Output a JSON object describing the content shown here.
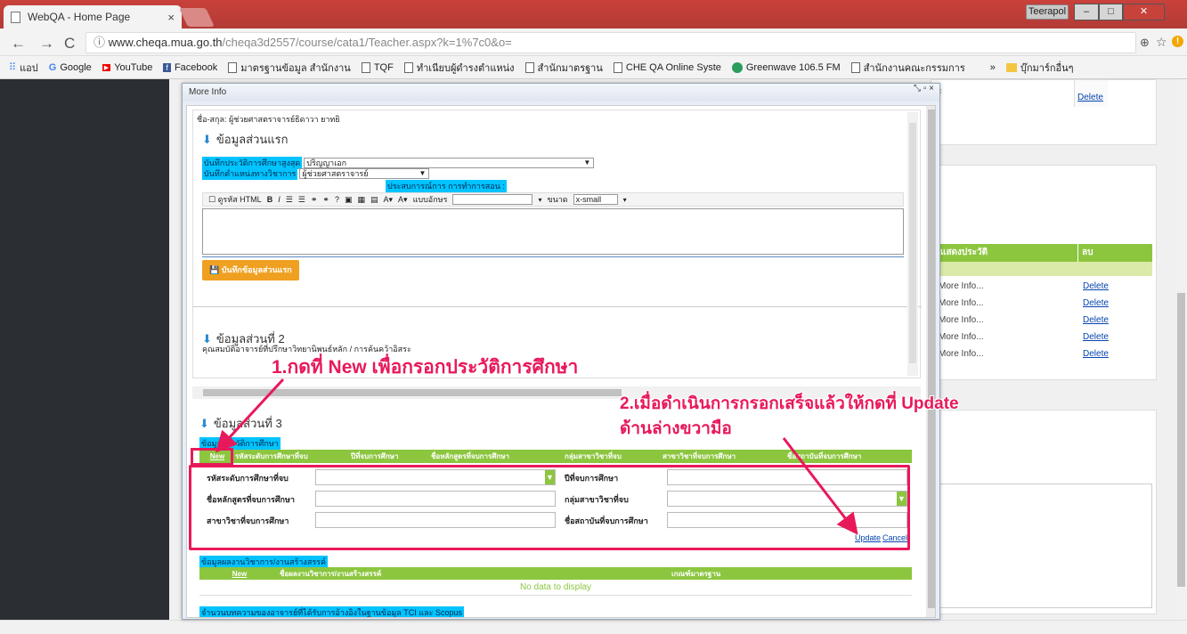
{
  "browser": {
    "tab_title": "WebQA - Home Page",
    "tab_close": "×",
    "user": "Teerapol",
    "url_host": "www.cheqa.mua.go.th",
    "url_path": "/cheqa3d2557/course/cata1/Teacher.aspx?k=1%7c0&o=",
    "bookmarks": [
      "แอป",
      "Google",
      "YouTube",
      "Facebook",
      "มาตรฐานข้อมูล สำนักงาน",
      "TQF",
      "ทำเนียบผู้ดำรงตำแหน่ง",
      "สำนักมาตรฐาน",
      "CHE QA Online Syste",
      "Greenwave 106.5 FM",
      "สำนักงานคณะกรรมการ"
    ],
    "bookmarks_more": "»",
    "bookmark_folder": "บุ๊กมาร์กอื่นๆ"
  },
  "right_panel": {
    "delete_top": "Delete",
    "col1": "แสดงประวัติ",
    "col2": "ลบ",
    "rows": [
      {
        "info": "More Info...",
        "del": "Delete"
      },
      {
        "info": "More Info...",
        "del": "Delete"
      },
      {
        "info": "More Info...",
        "del": "Delete"
      },
      {
        "info": "More Info...",
        "del": "Delete"
      },
      {
        "info": "More Info...",
        "del": "Delete"
      }
    ]
  },
  "modal": {
    "title": "More Info",
    "controls": "⤡ ▫ ×",
    "name_line": "ชื่อ-สกุล: ผู้ช่วยศาสตราจารย์ธิดาวา ยาทยิ",
    "section1": {
      "title": "ข้อมูลส่วนแรก",
      "edu_label": "บันทึกประวัติการศึกษาสูงสุด",
      "edu_value": "ปริญญาเอก",
      "pos_label": "บันทึกตำแหน่งทางวิชาการ",
      "pos_value": "ผู้ช่วยศาสตราจารย์",
      "exp_label": "ประสบการณ์การ การทำการสอน :",
      "toolbar_html": "ดูรหัส HTML",
      "font_label": "แบบอักษร",
      "size_label": "ขนาด",
      "size_value": "x-small",
      "save_button": "บันทึกข้อมูลส่วนแรก"
    },
    "section2": {
      "title": "ข้อมูลส่วนที่ 2",
      "subtitle": "คุณสมบัติอาจารย์ที่ปรึกษาวิทยานิพนธ์หลัก / การค้นคว้าอิสระ"
    },
    "section3": {
      "title": "ข้อมูลส่วนที่ 3",
      "edu_history_label": "ข้อมูลประวัติการศึกษา",
      "new_link": "New",
      "columns": [
        "รหัสระดับการศึกษาที่จบ",
        "ปีที่จบการศึกษา",
        "ชื่อหลักสูตรที่จบการศึกษา",
        "กลุ่มสาขาวิชาที่จบ",
        "สาขาวิชาที่จบการศึกษา",
        "ชื่อสถาบันที่จบการศึกษา"
      ],
      "form": {
        "level_label": "รหัสระดับการศึกษาที่จบ",
        "year_label": "ปีที่จบการศึกษา",
        "course_label": "ชื่อหลักสูตรที่จบการศึกษา",
        "group_label": "กลุ่มสาขาวิชาที่จบ",
        "major_label": "สาขาวิชาที่จบการศึกษา",
        "inst_label": "ชื่อสถาบันที่จบการศึกษา",
        "update": "Update",
        "cancel": "Cancel"
      },
      "works_label": "ข้อมูลผลงานวิชาการ/งานสร้างสรรค์",
      "works_new": "New",
      "works_col1": "ชื่อผลงานวิชาการ/งานสร้างสรรค์",
      "works_col2": "เกณฑ์มาตรฐาน",
      "no_data": "No data to display",
      "tci_label": "จำนวนบทความของอาจารย์ที่ได้รับการอ้างอิงในฐานข้อมูล TCI และ Scopus"
    }
  },
  "annotations": {
    "step1": "1.กดที่ New เพื่อกรอกประวัติการศึกษา",
    "step2_line1": "2.เมื่อดำเนินการกรอกเสร็จแล้วให้กดที่ Update",
    "step2_line2": "ด้านล่างขวามือ"
  },
  "colors": {
    "accent_green": "#8cc63f",
    "annotation": "#e8195a",
    "highlight": "#00c3ff",
    "orange": "#f0a020"
  }
}
